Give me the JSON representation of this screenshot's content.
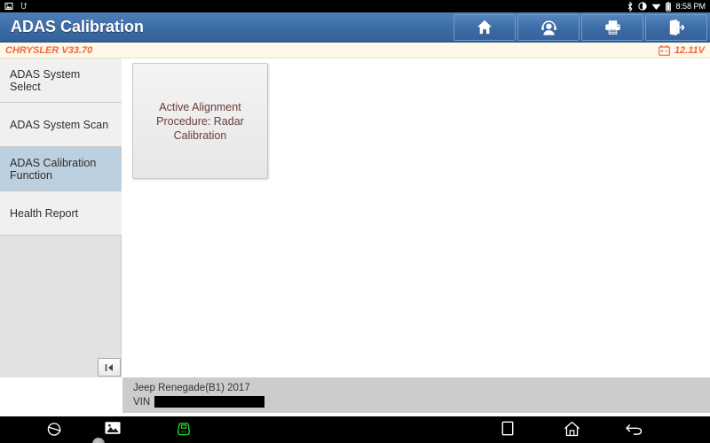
{
  "statusbar": {
    "left_icons": [
      "screenshot-icon",
      "usb-icon"
    ],
    "right_icons": [
      "bluetooth-icon",
      "brightness-icon",
      "wifi-icon",
      "battery-icon"
    ],
    "time": "8:58 PM"
  },
  "header": {
    "title": "ADAS Calibration",
    "buttons": [
      {
        "name": "home-button",
        "icon": "home-icon"
      },
      {
        "name": "support-button",
        "icon": "headset-person-icon"
      },
      {
        "name": "print-button",
        "icon": "printer-icon"
      },
      {
        "name": "exit-button",
        "icon": "exit-door-icon"
      }
    ]
  },
  "version_bar": {
    "vehicle_version": "CHRYSLER V33.70",
    "voltage": "12.11V",
    "voltage_icon": "car-battery-icon",
    "accent_color": "#f4663c"
  },
  "sidebar": {
    "items": [
      {
        "label": "ADAS System Select",
        "selected": false
      },
      {
        "label": "ADAS System Scan",
        "selected": false
      },
      {
        "label": "ADAS Calibration Function",
        "selected": true
      },
      {
        "label": "Health Report",
        "selected": false
      }
    ],
    "selected_color": "#bdd0e0"
  },
  "main": {
    "cards": [
      {
        "label": "Active Alignment Procedure: Radar Calibration",
        "text_color": "#6b3b3b"
      }
    ]
  },
  "collapse_button": {
    "name": "collapse-sidebar-button",
    "icon": "collapse-left-icon"
  },
  "vehicle_info": {
    "vehicle": "Jeep Renegade(B1) 2017",
    "vin_label": "VIN",
    "vin_value": ""
  },
  "navbar": {
    "items": [
      {
        "name": "browser-icon"
      },
      {
        "name": "gallery-icon"
      },
      {
        "name": "vci-icon"
      },
      {
        "name": "recents-icon"
      },
      {
        "name": "home-icon"
      },
      {
        "name": "back-icon"
      }
    ],
    "vci_color": "#22cc22"
  }
}
